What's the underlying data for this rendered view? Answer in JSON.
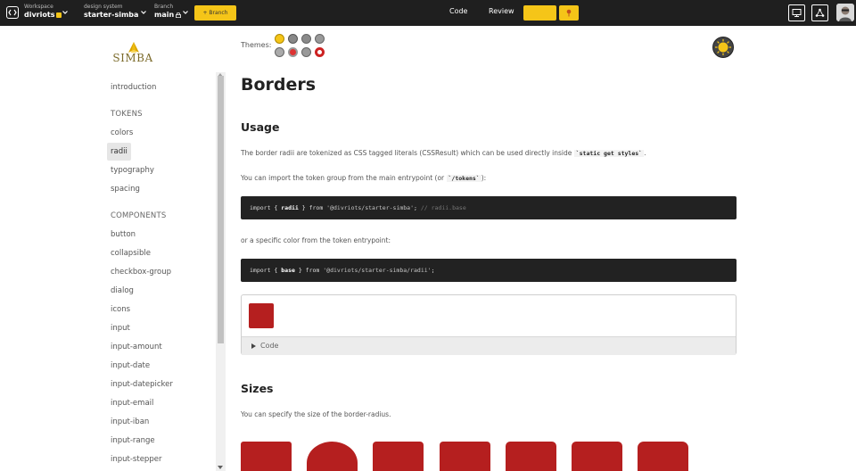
{
  "topbar": {
    "workspace_label": "Workspace",
    "workspace_value": "divriots",
    "design_system_label": "design system",
    "design_system_value": "starter-simba",
    "branch_label": "Branch",
    "branch_value": "main",
    "yellow_button_label": "+ Branch",
    "tab_code": "Code",
    "tab_review": "Review",
    "accent": "#f5c518"
  },
  "sidebar": {
    "logo_text": "SIMBA",
    "introduction": "introduction",
    "tokens_heading": "TOKENS",
    "tokens": [
      "colors",
      "radii",
      "typography",
      "spacing"
    ],
    "active_item": "radii",
    "components_heading": "COMPONENTS",
    "components": [
      "button",
      "collapsible",
      "checkbox-group",
      "dialog",
      "icons",
      "input",
      "input-amount",
      "input-date",
      "input-datepicker",
      "input-email",
      "input-iban",
      "input-range",
      "input-stepper"
    ]
  },
  "main": {
    "themes_label": "Themes:",
    "title": "Borders",
    "usage_heading": "Usage",
    "usage_text_before": "The border radii are tokenized as CSS tagged literals (CSSResult) which can be used directly inside ",
    "usage_code": "`static get styles`",
    "usage_text_after": ".",
    "import_text_before": "You can import the token group from the main entrypoint (or ",
    "import_code": "`/tokens`",
    "import_text_after": "):",
    "code1": {
      "import_kw": "import",
      "open": "{",
      "name": "radii",
      "close": "}",
      "from_kw": "from",
      "path": "'@divriots/starter-simba'",
      "semi": ";",
      "comment": "// radii.base"
    },
    "specific_text": "or a specific color from the token entrypoint:",
    "code2": {
      "import_kw": "import",
      "open": "{",
      "name": "base",
      "close": "}",
      "from_kw": "from",
      "path": "'@divriots/starter-simba/radii'",
      "semi": ";"
    },
    "demo_code_label": "Code",
    "sizes_heading": "Sizes",
    "sizes_text": "You can specify the size of the border-radius.",
    "swatch_color": "#b51f1f"
  }
}
